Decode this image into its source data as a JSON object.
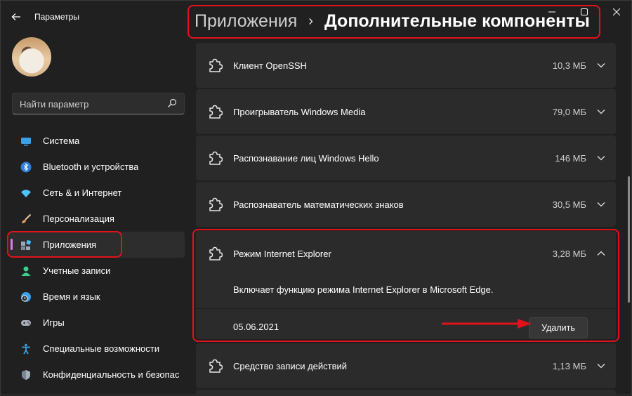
{
  "window": {
    "app_title": "Параметры"
  },
  "sidebar": {
    "search_placeholder": "Найти параметр",
    "items": [
      {
        "label": "Система",
        "icon": "system-icon",
        "color": "#3aa0e8"
      },
      {
        "label": "Bluetooth и устройства",
        "icon": "bluetooth-icon",
        "color": "#2f7fd8"
      },
      {
        "label": "Сеть & и Интернет",
        "icon": "wifi-icon",
        "color": "#4cc2ff"
      },
      {
        "label": "Персонализация",
        "icon": "brush-icon",
        "color": "#e8a25a"
      },
      {
        "label": "Приложения",
        "icon": "apps-icon",
        "color": "#9aa7b8",
        "active": true
      },
      {
        "label": "Учетные записи",
        "icon": "account-icon",
        "color": "#3ccf8e"
      },
      {
        "label": "Время и язык",
        "icon": "globe-clock-icon",
        "color": "#3aa0e8"
      },
      {
        "label": "Игры",
        "icon": "gamepad-icon",
        "color": "#a8b0bc"
      },
      {
        "label": "Специальные возможности",
        "icon": "accessibility-icon",
        "color": "#3aa0e8"
      },
      {
        "label": "Конфиденциальность и безопас",
        "icon": "shield-icon",
        "color": "#a8b0bc"
      }
    ]
  },
  "header": {
    "parent": "Приложения",
    "separator": "›",
    "current": "Дополнительные компоненты"
  },
  "features": [
    {
      "name": "Клиент OpenSSH",
      "size": "10,3 МБ",
      "expanded": false
    },
    {
      "name": "Проигрыватель Windows Media",
      "size": "79,0 МБ",
      "expanded": false
    },
    {
      "name": "Распознавание лиц Windows Hello",
      "size": "146 МБ",
      "expanded": false
    },
    {
      "name": "Распознаватель математических знаков",
      "size": "30,5 МБ",
      "expanded": false
    },
    {
      "name": "Режим Internet Explorer",
      "size": "3,28 МБ",
      "expanded": true,
      "description": "Включает функцию режима Internet Explorer в Microsoft Edge.",
      "date": "05.06.2021",
      "remove_label": "Удалить"
    },
    {
      "name": "Средство записи действий",
      "size": "1,13 МБ",
      "expanded": false
    }
  ],
  "colors": {
    "background": "#202020",
    "card": "#2b2b2b",
    "accent": "#e07cf0",
    "annotation": "#e2121c"
  }
}
